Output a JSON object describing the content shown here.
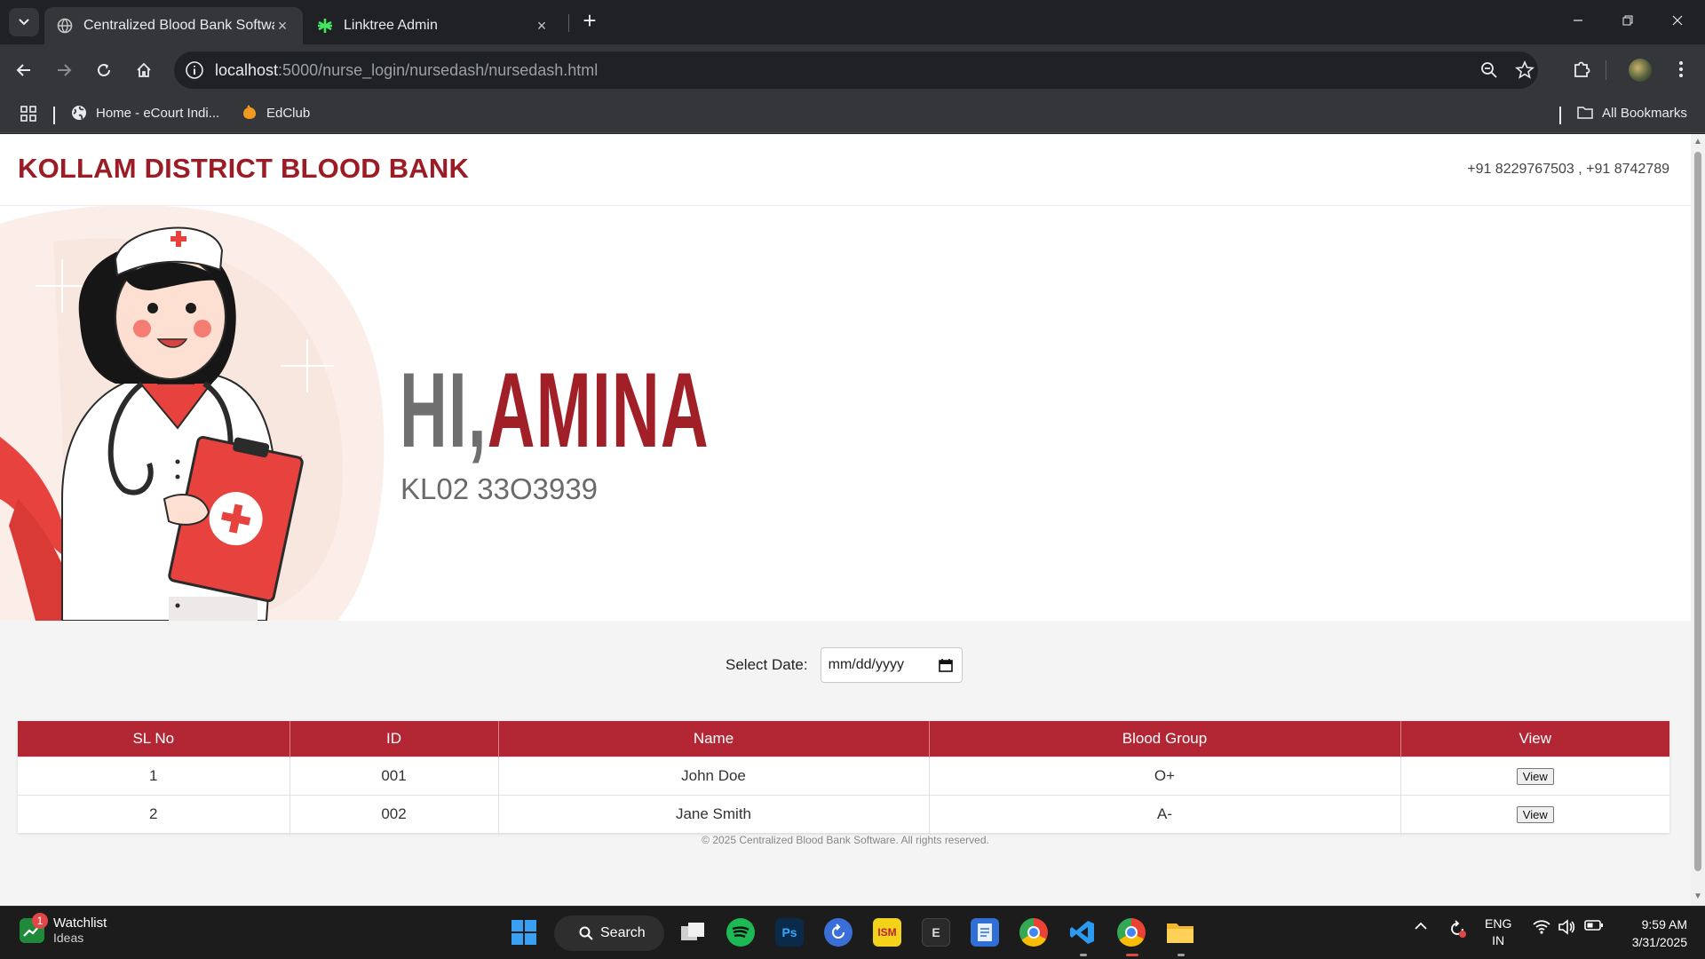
{
  "browser": {
    "tabs": [
      {
        "title": "Centralized Blood Bank Softwar",
        "active": true
      },
      {
        "title": "Linktree Admin",
        "active": false
      }
    ],
    "url_host": "localhost",
    "url_path": ":5000/nurse_login/nursedash/nursedash.html",
    "bookmarks": [
      {
        "label": "Home - eCourt Indi...",
        "icon": "globe-icon"
      },
      {
        "label": "EdClub",
        "icon": "edclub-icon"
      }
    ],
    "all_bookmarks_label": "All Bookmarks"
  },
  "header": {
    "brand": "KOLLAM DISTRICT BLOOD BANK",
    "phones": "+91 8229767503 , +91 8742789"
  },
  "hero": {
    "greeting_hi": "HI,",
    "greeting_name": "AMINA",
    "staff_id": "KL02 33O3939"
  },
  "filter": {
    "label": "Select Date:",
    "placeholder": "mm/dd/yyyy"
  },
  "table": {
    "columns": [
      "SL No",
      "ID",
      "Name",
      "Blood Group",
      "View"
    ],
    "rows": [
      {
        "sl": "1",
        "id": "001",
        "name": "John Doe",
        "blood_group": "O+",
        "action": "View"
      },
      {
        "sl": "2",
        "id": "002",
        "name": "Jane Smith",
        "blood_group": "A-",
        "action": "View"
      }
    ]
  },
  "footer": {
    "text": "© 2025 Centralized Blood Bank Software. All rights reserved."
  },
  "taskbar": {
    "widget_title": "Watchlist",
    "widget_sub": "Ideas",
    "widget_badge": "1",
    "search_label": "Search",
    "lang_top": "ENG",
    "lang_bottom": "IN",
    "time": "9:59 AM",
    "date": "3/31/2025"
  },
  "colors": {
    "brand_red": "#9b1c25",
    "table_header": "#b22733",
    "greeting_grey": "#6f6f6f"
  }
}
